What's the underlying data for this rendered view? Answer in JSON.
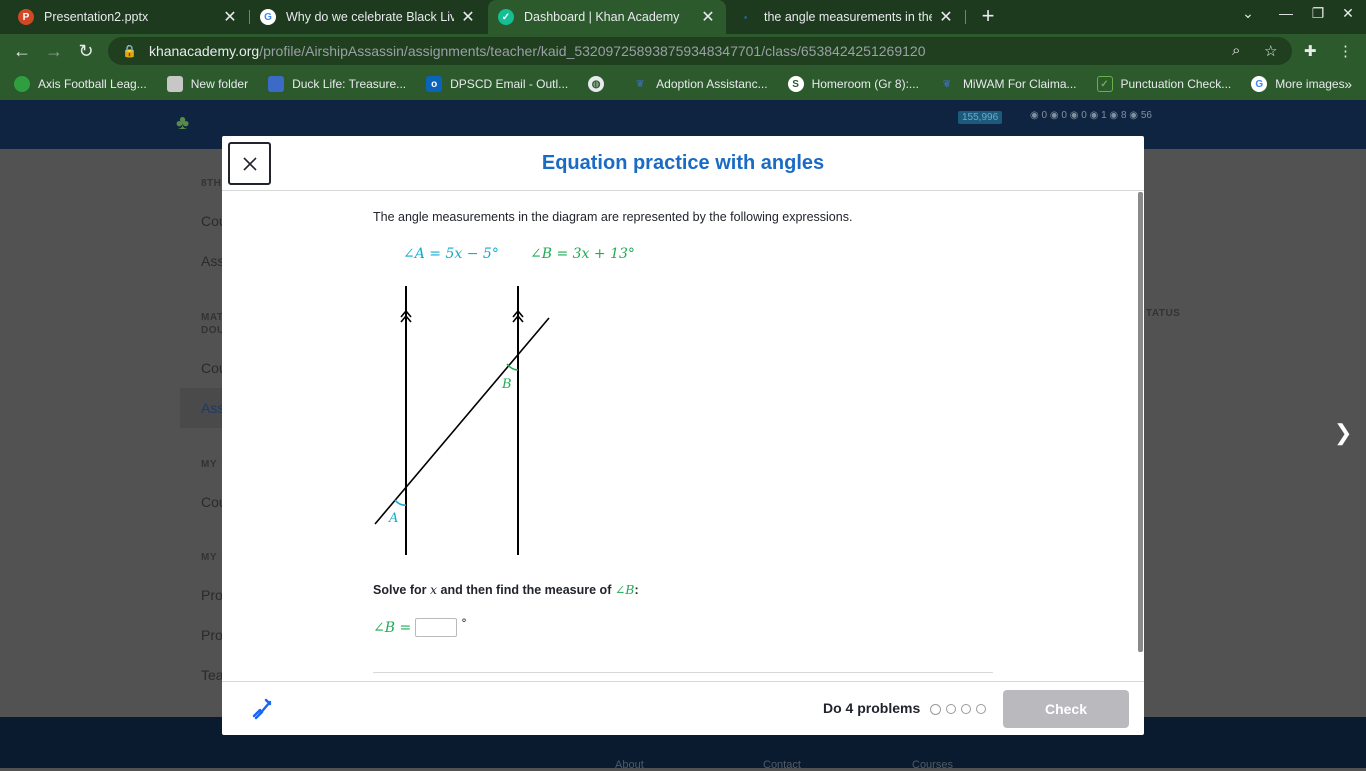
{
  "browser": {
    "tabs": [
      {
        "title": "Presentation2.pptx",
        "icon": "powerpoint-icon",
        "icon_color": "#d24726"
      },
      {
        "title": "Why do we celebrate Black Lives",
        "icon": "google-icon",
        "icon_color": "#ffffff"
      },
      {
        "title": "Dashboard | Khan Academy",
        "icon": "khan-academy-icon",
        "icon_color": "#14bf96"
      },
      {
        "title": "the angle measurements in the d",
        "icon": "loading-icon",
        "icon_color": "#1a73e8"
      }
    ],
    "url_host": "khanacademy.org",
    "url_path": "/profile/AirshipAssassin/assignments/teacher/kaid_532097258938759348347701/class/6538424251269120",
    "bookmarks": [
      {
        "label": "Axis Football Leag...",
        "icon": "green-circle-icon",
        "color": "#2e9e3e"
      },
      {
        "label": "New folder",
        "icon": "folder-icon",
        "color": "#c7c7c7"
      },
      {
        "label": "Duck Life: Treasure...",
        "icon": "duck-life-icon",
        "color": "#3b6ac7"
      },
      {
        "label": "DPSCD Email - Outl...",
        "icon": "outlook-icon",
        "color": "#0a64b9"
      },
      {
        "label": "",
        "icon": "globe-icon",
        "color": "#e8eaed"
      },
      {
        "label": "Adoption Assistanc...",
        "icon": "adoption-icon",
        "color": "#2d5a2d"
      },
      {
        "label": "Homeroom (Gr 8):...",
        "icon": "schoology-icon",
        "color": "#ffffff"
      },
      {
        "label": "MiWAM For Claima...",
        "icon": "miwam-icon",
        "color": "#2d5a2d"
      },
      {
        "label": "Punctuation Check...",
        "icon": "punctuation-icon",
        "color": "#6ab04c"
      },
      {
        "label": "More images",
        "icon": "google-icon",
        "color": "#ffffff"
      }
    ]
  },
  "background_page": {
    "points": "155,996",
    "badge_counts": [
      "0",
      "0",
      "0",
      "1",
      "8",
      "56"
    ],
    "sidebar_items": [
      "8TH",
      "Cou",
      "Ass",
      "MAT",
      "DOU",
      "Cou",
      "Ass",
      "MY",
      "Cou",
      "MY",
      "Pro",
      "Pro",
      "Tea"
    ],
    "status_header": "TATUS",
    "footer_links": [
      "About",
      "Contact",
      "Courses"
    ]
  },
  "modal": {
    "title": "Equation practice with angles",
    "prompt": "The angle measurements in the diagram are represented by the following expressions.",
    "expr_a": "∠A = 5x − 5°",
    "expr_b": "∠B = 3x + 13°",
    "diagram": {
      "label_a": "A",
      "label_b": "B"
    },
    "solve_text_before": "Solve for ",
    "solve_var": "x",
    "solve_text_mid": " and then find the measure of ",
    "solve_angle": "∠B",
    "solve_text_end": ":",
    "answer_label": "∠B =",
    "answer_value": "",
    "answer_unit": "°",
    "footer": {
      "progress_label": "Do 4 problems",
      "problem_count": 4,
      "check_label": "Check"
    }
  },
  "colors": {
    "title_blue": "#1a6bc4",
    "angle_a": "#11accd",
    "angle_b": "#1fab54",
    "check_disabled": "#bababe"
  }
}
